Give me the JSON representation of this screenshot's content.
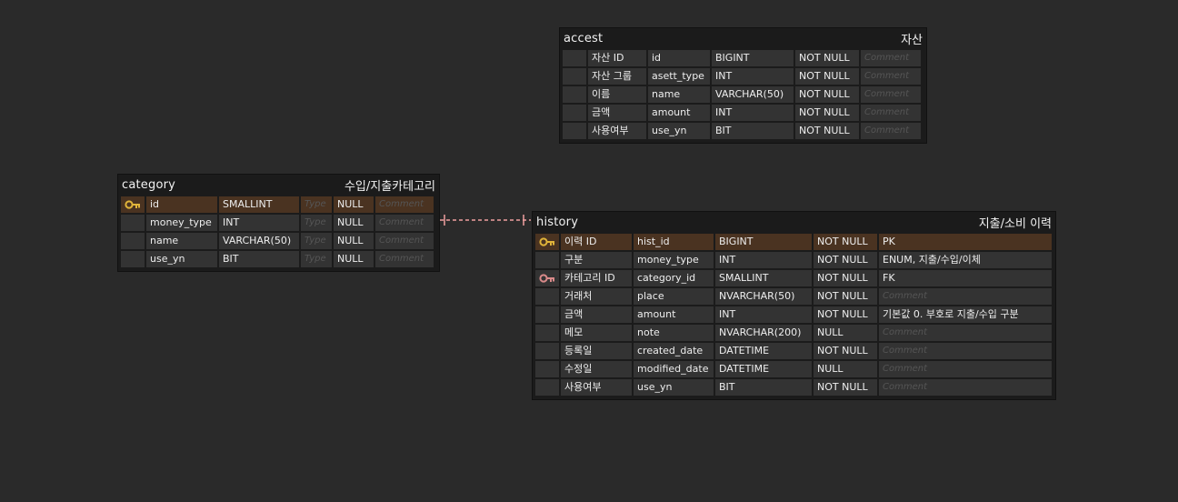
{
  "tables": {
    "accest": {
      "name": "accest",
      "comment": "자산",
      "rows": [
        {
          "logical": "자산 ID",
          "physical": "id",
          "type": "BIGINT",
          "nullable": "NOT NULL",
          "comment": "Comment"
        },
        {
          "logical": "자산 그룹",
          "physical": "asett_type",
          "type": "INT",
          "nullable": "NOT NULL",
          "comment": "Comment"
        },
        {
          "logical": "이름",
          "physical": "name",
          "type": "VARCHAR(50)",
          "nullable": "NOT NULL",
          "comment": "Comment"
        },
        {
          "logical": "금액",
          "physical": "amount",
          "type": "INT",
          "nullable": "NOT NULL",
          "comment": "Comment"
        },
        {
          "logical": "사용여부",
          "physical": "use_yn",
          "type": "BIT",
          "nullable": "NOT NULL",
          "comment": "Comment"
        }
      ]
    },
    "category": {
      "name": "category",
      "comment": "수입/지출카테고리",
      "rows": [
        {
          "physical": "id",
          "type": "SMALLINT",
          "type_placeholder": "Type",
          "nullable": "NULL",
          "comment": "Comment"
        },
        {
          "physical": "money_type",
          "type": "INT",
          "type_placeholder": "Type",
          "nullable": "NULL",
          "comment": "Comment"
        },
        {
          "physical": "name",
          "type": "VARCHAR(50)",
          "type_placeholder": "Type",
          "nullable": "NULL",
          "comment": "Comment"
        },
        {
          "physical": "use_yn",
          "type": "BIT",
          "type_placeholder": "Type",
          "nullable": "NULL",
          "comment": "Comment"
        }
      ]
    },
    "history": {
      "name": "history",
      "comment": "지출/소비 이력",
      "rows": [
        {
          "logical": "이력 ID",
          "physical": "hist_id",
          "type": "BIGINT",
          "nullable": "NOT NULL",
          "comment": "PK"
        },
        {
          "logical": "구분",
          "physical": "money_type",
          "type": "INT",
          "nullable": "NOT NULL",
          "comment": "ENUM, 지출/수입/이체"
        },
        {
          "logical": "카테고리 ID",
          "physical": "category_id",
          "type": "SMALLINT",
          "nullable": "NOT NULL",
          "comment": "FK"
        },
        {
          "logical": "거래처",
          "physical": "place",
          "type": "NVARCHAR(50)",
          "nullable": "NOT NULL",
          "comment": "Comment"
        },
        {
          "logical": "금액",
          "physical": "amount",
          "type": "INT",
          "nullable": "NOT NULL",
          "comment": "기본값 0. 부호로 지출/수입 구분"
        },
        {
          "logical": "메모",
          "physical": "note",
          "type": "NVARCHAR(200)",
          "nullable": "NULL",
          "comment": "Comment"
        },
        {
          "logical": "등록일",
          "physical": "created_date",
          "type": "DATETIME",
          "nullable": "NOT NULL",
          "comment": "Comment"
        },
        {
          "logical": "수정일",
          "physical": "modified_date",
          "type": "DATETIME",
          "nullable": "NULL",
          "comment": "Comment"
        },
        {
          "logical": "사용여부",
          "physical": "use_yn",
          "type": "BIT",
          "nullable": "NOT NULL",
          "comment": "Comment"
        }
      ]
    }
  },
  "icons": {
    "primary_key": "key-icon",
    "foreign_key": "key-icon"
  },
  "colors": {
    "background": "#2a2a2a",
    "table_bg": "#1b1b1b",
    "cell_bg": "#333333",
    "pk_row_bg": "#4a3321",
    "pk_key": "#e0b43a",
    "fk_key": "#d98a8a",
    "relation_line": "#f0a0a0",
    "placeholder_text": "#555555"
  }
}
